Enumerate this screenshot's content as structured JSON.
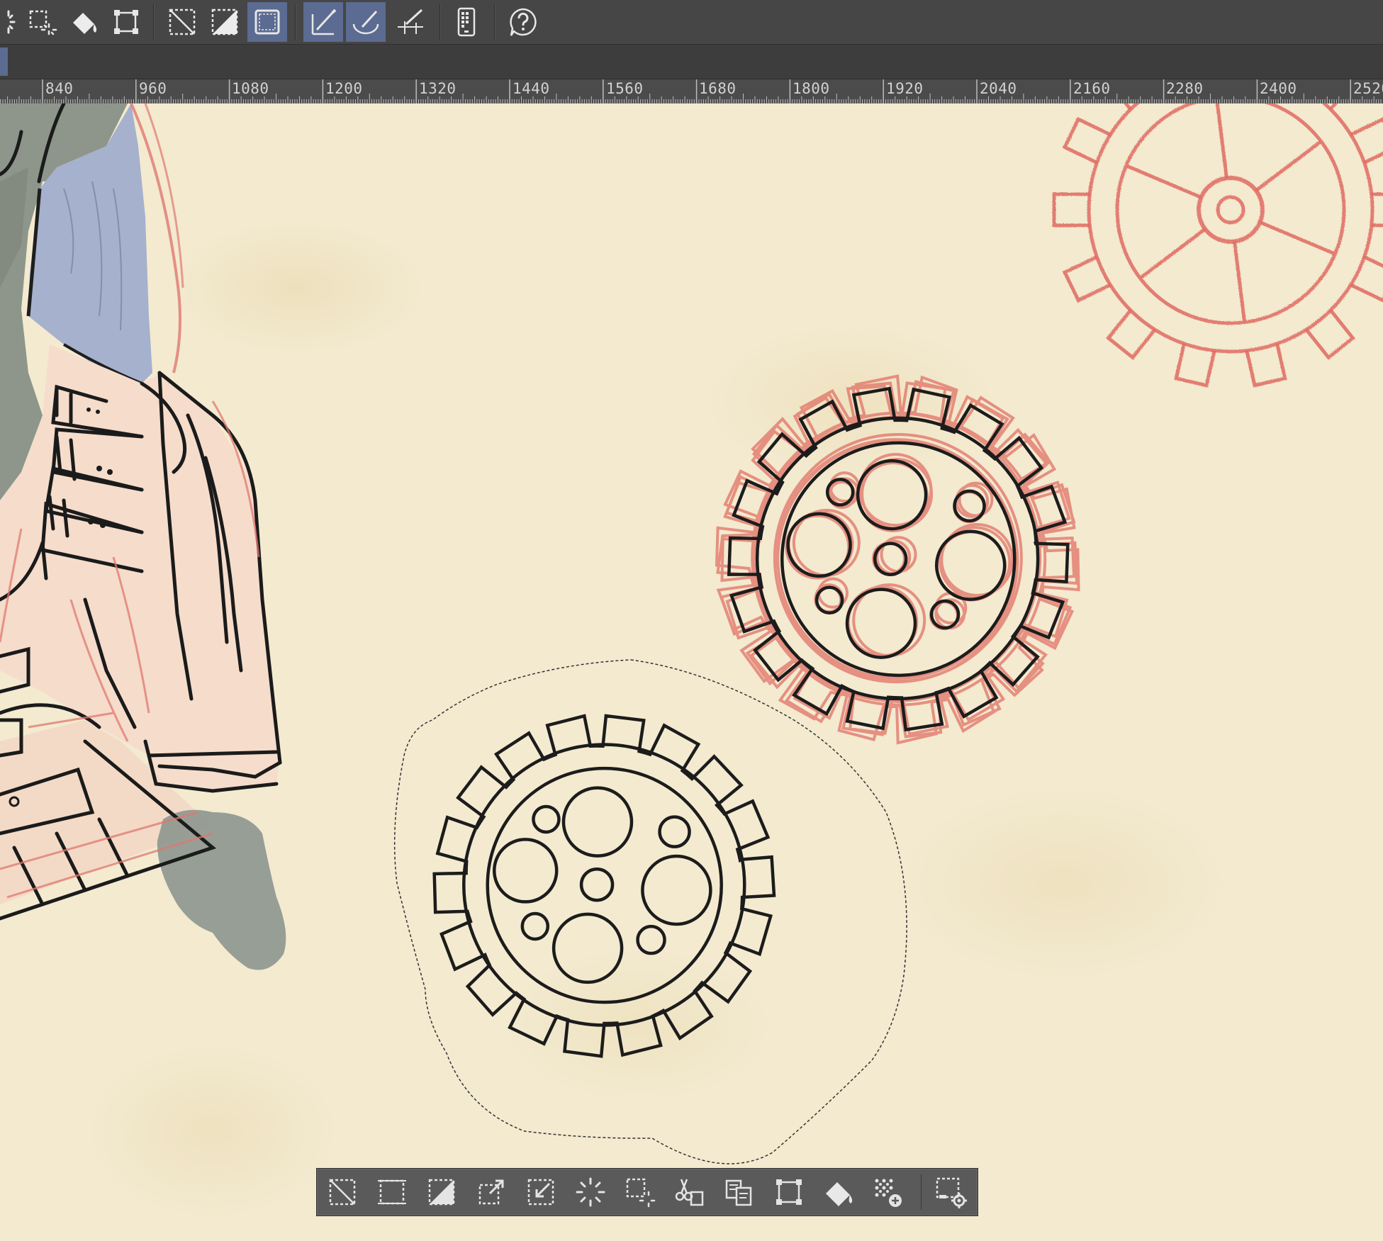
{
  "ruler": {
    "labels": [
      "840",
      "960",
      "1080",
      "1200",
      "1320",
      "1440",
      "1560",
      "1680",
      "1800",
      "1920",
      "2040",
      "2160",
      "2280",
      "2400",
      "2520"
    ]
  },
  "top_toolbar": {
    "buttons": [
      {
        "name": "lasso-select-icon",
        "active": false
      },
      {
        "name": "select-more-icon",
        "active": false
      },
      {
        "name": "fill-selection-icon",
        "active": false
      },
      {
        "name": "transform-icon",
        "active": false
      },
      {
        "name": "clear-selection-icon",
        "active": false
      },
      {
        "name": "invert-selection-icon",
        "active": false
      },
      {
        "name": "show-selection-border-icon",
        "active": true
      },
      {
        "name": "snap-to-ruler-icon",
        "active": true
      },
      {
        "name": "snap-to-special-ruler-icon",
        "active": true
      },
      {
        "name": "snap-to-grid-icon",
        "active": false
      },
      {
        "name": "tablet-mode-icon",
        "active": false
      },
      {
        "name": "help-icon",
        "active": false
      }
    ]
  },
  "selection_toolbar": {
    "buttons": [
      "deselect-icon",
      "select-all-icon",
      "invert-selected-area-icon",
      "expand-selected-area-icon",
      "shrink-selected-area-icon",
      "select-layer-icon",
      "select-more-outline-icon",
      "cut-paste-icon",
      "copy-paste-icon",
      "scale-rotate-icon",
      "fill-icon",
      "new-tone-icon",
      "selection-settings-icon"
    ]
  }
}
